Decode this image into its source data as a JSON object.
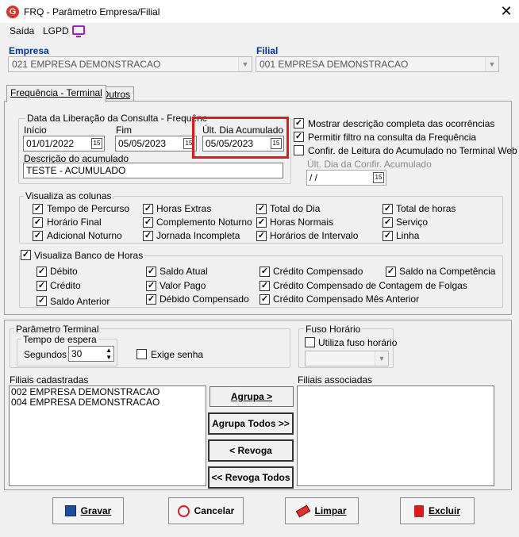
{
  "window": {
    "title": "FRQ - Parâmetro Empresa/Filial",
    "app_icon": "G"
  },
  "menu": {
    "saida": "Saída",
    "lgpd": "LGPD"
  },
  "empresa": {
    "label": "Empresa",
    "value": "021 EMPRESA DEMONSTRACAO"
  },
  "filial": {
    "label": "Filial",
    "value": "001 EMPRESA DEMONSTRACAO"
  },
  "tabs": [
    {
      "label": "Frequência - Terminal"
    },
    {
      "label": "Outros"
    }
  ],
  "liberacao": {
    "group_title": "Data da Liberação da Consulta  - Frequênc",
    "inicio_label": "Início",
    "inicio_value": "01/01/2022",
    "fim_label": "Fim",
    "fim_value": "05/05/2023",
    "ult_label": "Últ. Dia Acumulado",
    "ult_value": "05/05/2023",
    "desc_label": "Descrição do acumulado",
    "desc_value": "TESTE - ACUMULADO",
    "cal_glyph": "15"
  },
  "options": {
    "mostrar": "Mostrar descrição completa das ocorrências",
    "permitir": "Permitir filtro na consulta da Frequência",
    "confir": "Confir. de Leitura do Acumulado no Terminal Web",
    "ult_confir_label": "Últ. Dia da Confir. Acumulado",
    "ult_confir_value": " /  /"
  },
  "colunas": {
    "title": "Visualiza as colunas",
    "items": [
      "Tempo de Percurso",
      "Horas Extras",
      "Total do Dia",
      "Total de horas",
      "Horário Final",
      "Complemento Noturno",
      "Horas Normais",
      "Serviço",
      "Adicional Noturno",
      "Jornada Incompleta",
      "Horários de Intervalo",
      "Linha"
    ]
  },
  "banco": {
    "title": "Visualiza Banco de Horas",
    "items": [
      "Débito",
      "Saldo Atual",
      "Crédito Compensado",
      "Saldo na Competência",
      "Crédito",
      "Valor Pago",
      "Crédito Compensado de Contagem de Folgas",
      "Saldo Anterior",
      "Débido Compensado",
      "Crédito Compensado Mês Anterior"
    ]
  },
  "terminal": {
    "title": "Parâmetro Terminal",
    "espera_title": "Tempo de espera",
    "segundos_label": "Segundos",
    "segundos_value": "30",
    "exige_senha": "Exige senha"
  },
  "fuso": {
    "title": "Fuso Horário",
    "utiliza": "Utiliza fuso horário"
  },
  "filiais_cadastradas": {
    "label": "Filiais cadastradas",
    "items": [
      "002 EMPRESA DEMONSTRACAO",
      "004 EMPRESA DEMONSTRACAO"
    ]
  },
  "filiais_associadas": {
    "label": "Filiais associadas"
  },
  "transfer": {
    "agrupa": "Agrupa >",
    "agrupa_todos": "Agrupa Todos >>",
    "revoga": "< Revoga",
    "revoga_todos": "<< Revoga Todos"
  },
  "actions": {
    "gravar": "Gravar",
    "cancelar": "Cancelar",
    "limpar": "Limpar",
    "excluir": "Excluir"
  },
  "colors": {
    "accent_red": "#e01818",
    "label_blue": "#003399",
    "lgpd_purple": "#a020d0"
  }
}
